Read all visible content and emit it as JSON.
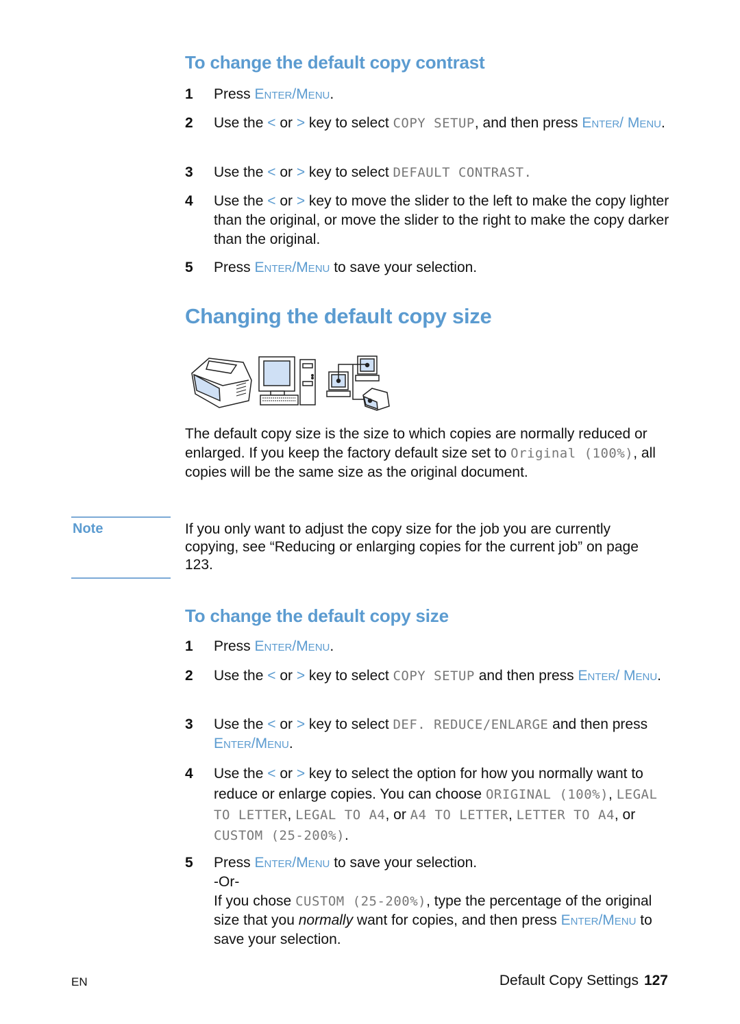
{
  "contrast_section": {
    "heading": "To change the default copy contrast",
    "steps": [
      {
        "num": "1",
        "pre": "Press ",
        "key": "Enter/Menu",
        "post": "."
      },
      {
        "num": "2",
        "pre": "Use the ",
        "lt": "<",
        "or": " or ",
        "gt": ">",
        "mid": " key to select ",
        "lcd": "COPY SETUP",
        "post": ", and then press ",
        "key": "Enter/ Menu",
        "end": "."
      },
      {
        "num": "3",
        "pre": "Use the ",
        "lt": "<",
        "or": " or ",
        "gt": ">",
        "mid": " key to select ",
        "lcd": "DEFAULT CONTRAST."
      },
      {
        "num": "4",
        "pre": "Use the ",
        "lt": "<",
        "or": " or ",
        "gt": ">",
        "mid": " key to move the slider to the left to make the copy lighter than the original, or move the slider to the right to make the copy darker than the original."
      },
      {
        "num": "5",
        "pre": "Press ",
        "key": "Enter/Menu",
        "post": " to save your selection."
      }
    ]
  },
  "size_section": {
    "title": "Changing the default copy size",
    "icons": [
      "fax-machine-icon",
      "computer-icon",
      "network-icon"
    ],
    "intro": {
      "line1": "The default copy size is the size to which copies are normally reduced or enlarged. If you keep the factory default size set to ",
      "lcd": "Original (100%)",
      "line2": ", all copies will be the same size as the original document."
    },
    "note": {
      "label": "Note",
      "text": "If you only want to adjust the copy size for the job you are currently copying, see “Reducing or enlarging copies for the current job” on page 123."
    }
  },
  "size_steps_section": {
    "heading": "To change the default copy size",
    "steps": [
      {
        "num": "1",
        "pre": "Press ",
        "key": "Enter/Menu",
        "post": "."
      },
      {
        "num": "2",
        "pre": "Use the ",
        "lt": "<",
        "or": " or ",
        "gt": ">",
        "mid": " key to select ",
        "lcd": "COPY SETUP",
        "post": " and then press ",
        "key": "Enter/ Menu",
        "end": "."
      },
      {
        "num": "3",
        "pre": "Use the ",
        "lt": "<",
        "or": " or ",
        "gt": ">",
        "mid": " key to select ",
        "lcd": "DEF. REDUCE/ENLARGE",
        "post": " and then press ",
        "key": "Enter/Menu",
        "end": "."
      },
      {
        "num": "4",
        "pre": "Use the ",
        "lt": "<",
        "or": " or ",
        "gt": ">",
        "mid": " key to select the option for how you normally want to reduce or enlarge copies. You can choose ",
        "opt1": "ORIGINAL (100%)",
        "c1": ", ",
        "opt2": "LEGAL TO LETTER",
        "c2": ", ",
        "opt3": "LEGAL TO A4",
        "c3": ", or ",
        "opt4": "A4 TO LETTER",
        "c4": ", ",
        "opt5": "LETTER TO A4",
        "c5": ", or ",
        "opt6": "CUSTOM (25-200%)",
        "end": "."
      },
      {
        "num": "5",
        "pre": "Press ",
        "key": "Enter/Menu",
        "post": " to save your selection.",
        "or_line": "-Or-",
        "alt_pre": "If you chose ",
        "alt_lcd": "CUSTOM (25-200%)",
        "alt_mid": ", type the percentage of the original size that you ",
        "alt_em": "normally",
        "alt_post": " want for copies, and then press ",
        "alt_key": "Enter/Menu",
        "alt_end": " to save your selection."
      }
    ]
  },
  "footer": {
    "lang": "EN",
    "section": "Default Copy Settings",
    "page": "127"
  }
}
